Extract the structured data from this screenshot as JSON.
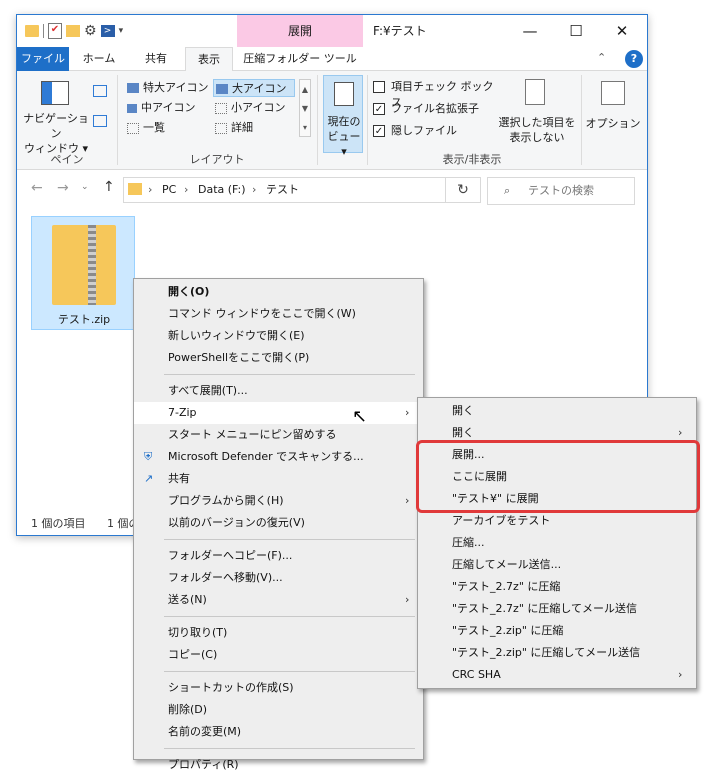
{
  "window": {
    "context_tab": "展開",
    "title": "F:¥テスト",
    "minimize": "—",
    "maximize": "☐",
    "close": "✕"
  },
  "ribbon_tabs": [
    "ファイル",
    "ホーム",
    "共有",
    "表示",
    "圧縮フォルダー ツール"
  ],
  "ribbon": {
    "pane_group": {
      "nav_pane_line1": "ナビゲーション",
      "nav_pane_line2": "ウィンドウ ▾",
      "label": "ペイン"
    },
    "layout_group": {
      "items": [
        "特大アイコン",
        "大アイコン",
        "中アイコン",
        "小アイコン",
        "一覧",
        "詳細"
      ],
      "label": "レイアウト"
    },
    "current_view": {
      "line1": "現在の",
      "line2": "ビュー ▾"
    },
    "show_hide_group": {
      "checkboxes": [
        {
          "label": "項目チェック ボックス",
          "checked": false
        },
        {
          "label": "ファイル名拡張子",
          "checked": true
        },
        {
          "label": "隠しファイル",
          "checked": true
        }
      ],
      "hide_selected_line1": "選択した項目を",
      "hide_selected_line2": "表示しない",
      "label": "表示/非表示"
    },
    "options": "オプション"
  },
  "address": {
    "path": [
      "PC",
      "Data (F:)",
      "テスト"
    ],
    "search_placeholder": "テストの検索"
  },
  "file": {
    "name": "テスト.zip"
  },
  "status": {
    "count": "1 個の項目",
    "count2": "1 個の"
  },
  "context_menu": [
    {
      "label": "開く(O)",
      "bold": true
    },
    {
      "label": "コマンド ウィンドウをここで開く(W)"
    },
    {
      "label": "新しいウィンドウで開く(E)"
    },
    {
      "label": "PowerShellをここで開く(P)"
    },
    {
      "sep": true
    },
    {
      "label": "すべて展開(T)..."
    },
    {
      "label": "7-Zip",
      "submenu": true,
      "hl": true
    },
    {
      "label": "スタート メニューにピン留めする"
    },
    {
      "label": "Microsoft Defender でスキャンする...",
      "icon": "defender"
    },
    {
      "label": "共有",
      "icon": "share"
    },
    {
      "label": "プログラムから開く(H)",
      "submenu": true
    },
    {
      "label": "以前のバージョンの復元(V)"
    },
    {
      "sep": true
    },
    {
      "label": "フォルダーへコピー(F)..."
    },
    {
      "label": "フォルダーへ移動(V)..."
    },
    {
      "label": "送る(N)",
      "submenu": true
    },
    {
      "sep": true
    },
    {
      "label": "切り取り(T)"
    },
    {
      "label": "コピー(C)"
    },
    {
      "sep": true
    },
    {
      "label": "ショートカットの作成(S)"
    },
    {
      "label": "削除(D)"
    },
    {
      "label": "名前の変更(M)"
    },
    {
      "sep": true
    },
    {
      "label": "プロパティ(R)"
    }
  ],
  "zip_menu": [
    {
      "label": "開く"
    },
    {
      "label": "開く",
      "submenu": true
    },
    {
      "label": "展開..."
    },
    {
      "label": "ここに展開"
    },
    {
      "label": "\"テスト¥\" に展開"
    },
    {
      "label": "アーカイブをテスト"
    },
    {
      "label": "圧縮..."
    },
    {
      "label": "圧縮してメール送信..."
    },
    {
      "label": "\"テスト_2.7z\" に圧縮"
    },
    {
      "label": "\"テスト_2.7z\" に圧縮してメール送信"
    },
    {
      "label": "\"テスト_2.zip\" に圧縮"
    },
    {
      "label": "\"テスト_2.zip\" に圧縮してメール送信"
    },
    {
      "label": "CRC SHA",
      "submenu": true
    }
  ],
  "colors": {
    "accent": "#1e6fc8",
    "context_tab": "#fbc9e5",
    "highlight_box": "#e0393a",
    "folder": "#f6c75a"
  }
}
